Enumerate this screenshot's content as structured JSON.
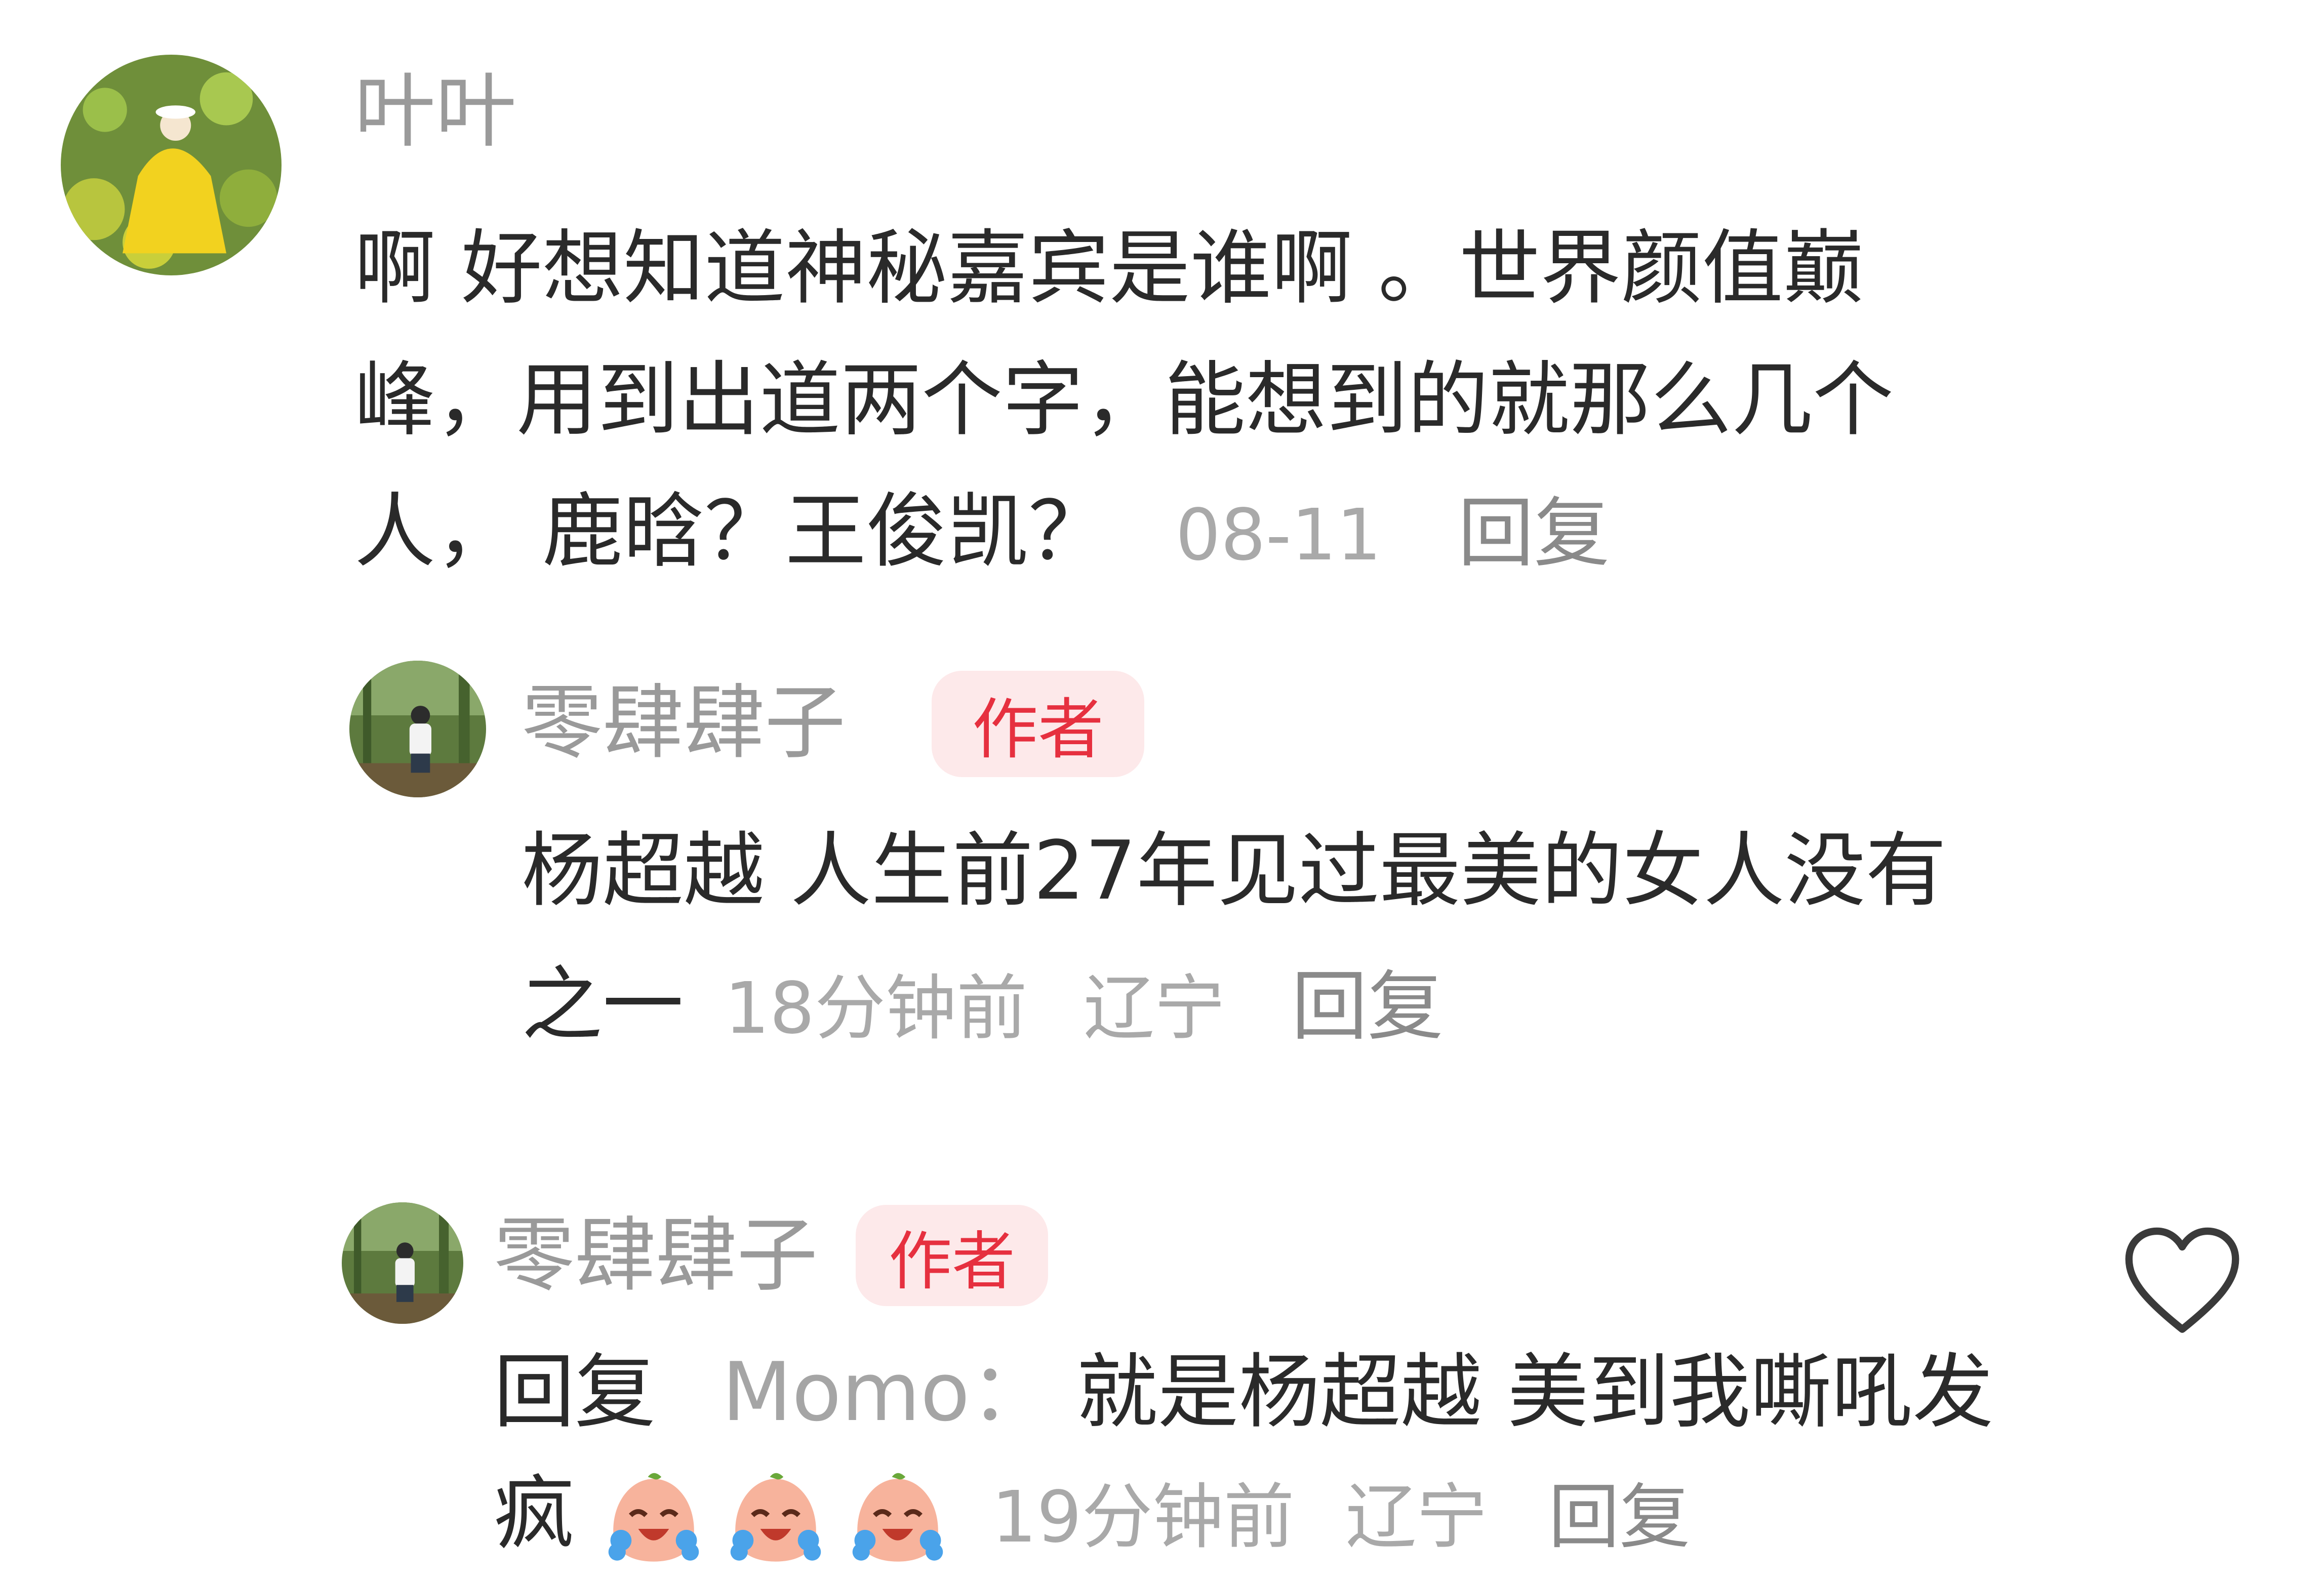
{
  "comment1": {
    "username": "叶叶",
    "lines": [
      "啊 好想知道神秘嘉宾是谁啊 。世界颜值巅",
      "峰，用到出道两个字，能想到的就那么几个",
      "人， 鹿晗？王俊凯？"
    ],
    "date": "08-11",
    "reply_label": "回复"
  },
  "reply1": {
    "username": "零肆肆子",
    "badge": "作者",
    "lines": [
      "杨超越 人生前27年见过最美的女人没有",
      "之一"
    ],
    "time": "18分钟前",
    "location": "辽宁",
    "reply_label": "回复"
  },
  "reply2": {
    "username": "零肆肆子",
    "badge": "作者",
    "reply_prefix": "回复",
    "reply_target": "Momo：",
    "lines": [
      "就是杨超越 美到我嘶吼发",
      "疯"
    ],
    "emojis": [
      "crying-laughing-emoji",
      "crying-laughing-emoji",
      "crying-laughing-emoji"
    ],
    "time": "19分钟前",
    "location": "辽宁",
    "reply_label": "回复"
  },
  "icons": {
    "like": "heart-icon"
  },
  "colors": {
    "badge_bg": "#fde9ea",
    "badge_text": "#e6303f",
    "username": "#9a9a9a",
    "body_text": "#2a2a2a",
    "meta_text": "#a9a9a9"
  }
}
